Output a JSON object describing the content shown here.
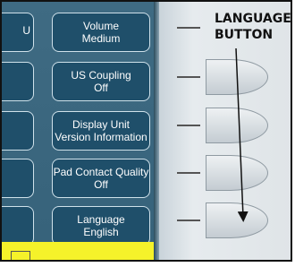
{
  "menu": {
    "items": [
      {
        "title": "Volume",
        "value": "Medium"
      },
      {
        "title": "US Coupling",
        "value": "Off"
      },
      {
        "title": "Display Unit",
        "value": "Version Information"
      },
      {
        "title": "Pad Contact Quality",
        "value": "Off"
      },
      {
        "title": "Language",
        "value": "English"
      }
    ]
  },
  "left_column": {
    "fragments": [
      "U",
      "",
      "",
      "",
      ""
    ]
  },
  "annotation": {
    "line1": "LANGUAGE",
    "line2": "BUTTON"
  },
  "colors": {
    "button_fill": "#1f4f6a",
    "screen_bg": "#3f6b83",
    "status_bar": "#f5f22a"
  }
}
